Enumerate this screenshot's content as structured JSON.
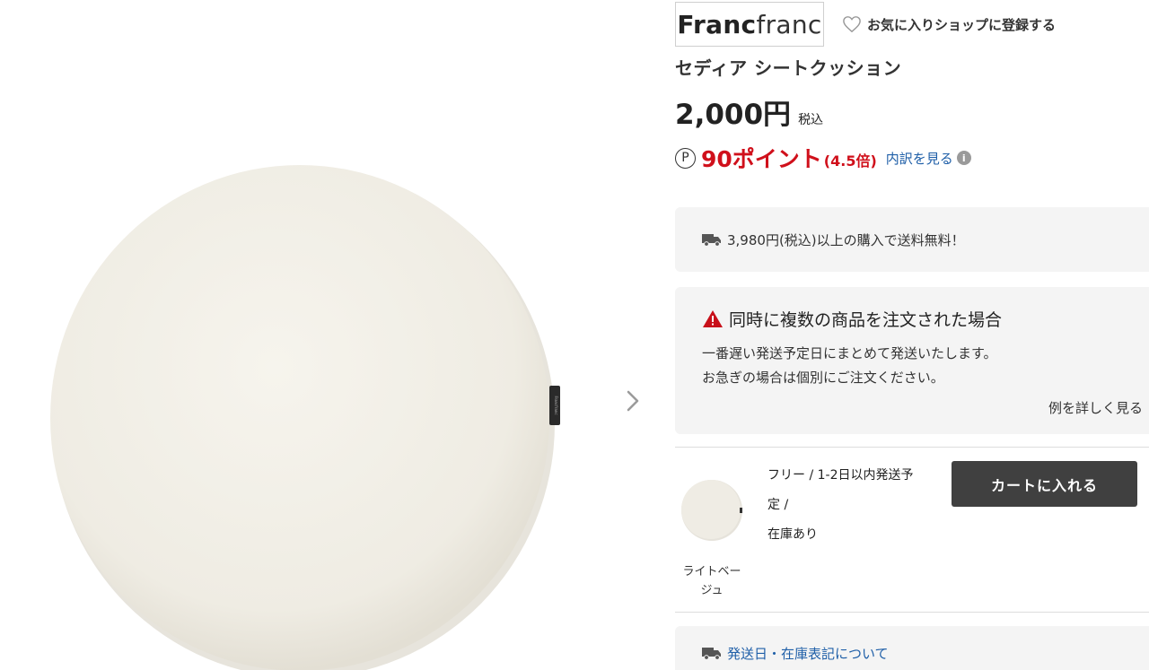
{
  "gallery": {
    "next_icon": "chevron-right-icon",
    "tag_text": "Francfranc"
  },
  "brand": {
    "logo_bold": "Franc",
    "logo_light": "franc",
    "favorite_icon": "heart-outline-icon",
    "favorite_label": "お気に入りショップに登録する"
  },
  "product": {
    "title": "セディア シートクッション",
    "price": "2,000円",
    "tax_label": "税込"
  },
  "points": {
    "icon_glyph": "P",
    "amount": "90ポイント",
    "multiplier": "(4.5倍)",
    "breakdown_link": "内訳を見る",
    "info_glyph": "i"
  },
  "shipping": {
    "icon": "truck-icon",
    "text": "3,980円(税込)以上の購入で送料無料！"
  },
  "notice": {
    "icon": "warning-icon",
    "title": "同時に複数の商品を注文された場合",
    "line1": "一番遅い発送予定日にまとめて発送いたします。",
    "line2": "お急ぎの場合は個別にご注文ください。",
    "more_link": "例を詳しく見る"
  },
  "variant": {
    "color_line1": "ライトベー",
    "color_line2": "ジュ",
    "stock_line1": "フリー / 1-2日以内発送予",
    "stock_line2": "定 /",
    "stock_line3": "在庫あり",
    "cart_button": "カートに入れる"
  },
  "delivery": {
    "icon": "truck-icon",
    "link": "発送日・在庫表記について"
  },
  "colors": {
    "points_red": "#d0101b",
    "link_blue": "#1f5fa8",
    "cart_button_bg": "#404040",
    "warning_red": "#c8101a"
  }
}
